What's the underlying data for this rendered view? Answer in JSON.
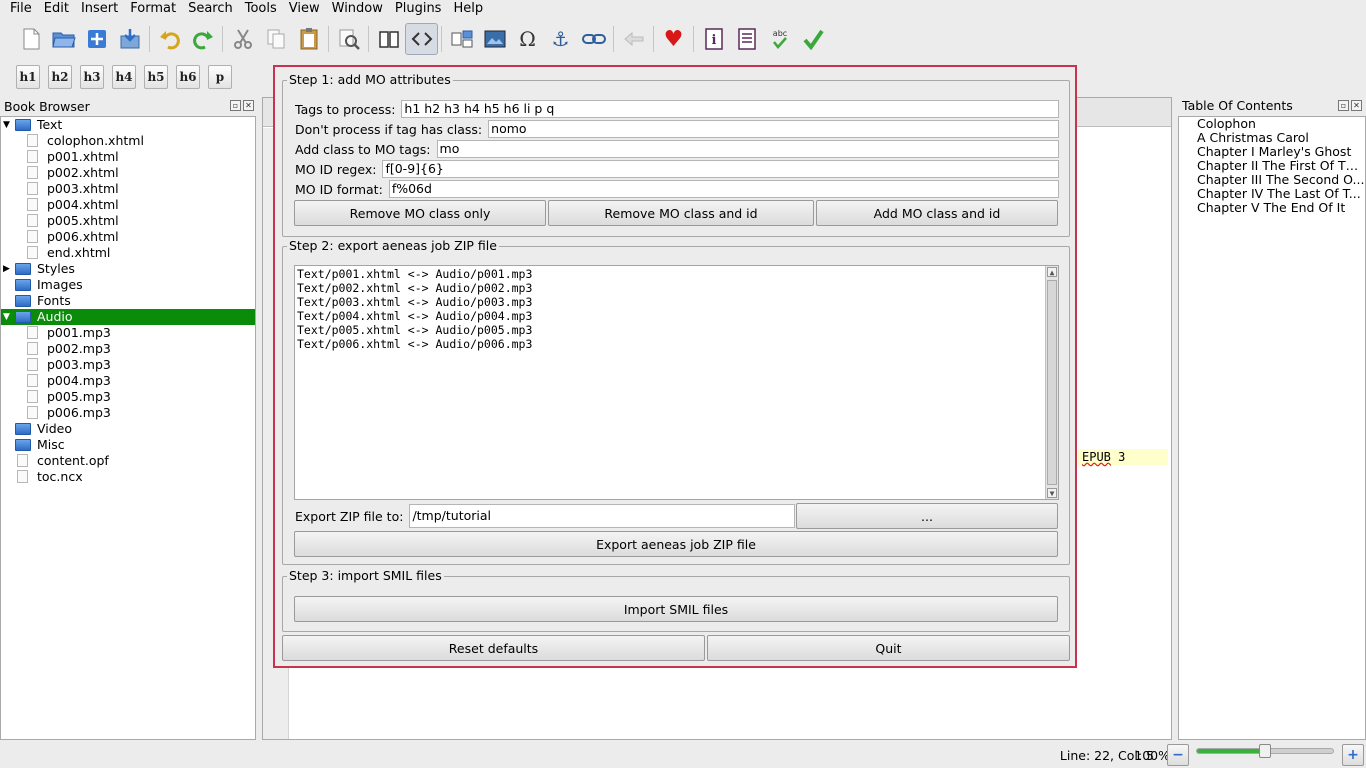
{
  "menu": [
    "File",
    "Edit",
    "Insert",
    "Format",
    "Search",
    "Tools",
    "View",
    "Window",
    "Plugins",
    "Help"
  ],
  "heading_buttons": [
    "h1",
    "h2",
    "h3",
    "h4",
    "h5",
    "h6",
    "p"
  ],
  "book_browser": {
    "title": "Book Browser",
    "tree": [
      {
        "label": "Text",
        "type": "folder",
        "expanded": true
      },
      {
        "label": "colophon.xhtml",
        "type": "file",
        "child": true
      },
      {
        "label": "p001.xhtml",
        "type": "file",
        "child": true
      },
      {
        "label": "p002.xhtml",
        "type": "file",
        "child": true
      },
      {
        "label": "p003.xhtml",
        "type": "file",
        "child": true
      },
      {
        "label": "p004.xhtml",
        "type": "file",
        "child": true
      },
      {
        "label": "p005.xhtml",
        "type": "file",
        "child": true
      },
      {
        "label": "p006.xhtml",
        "type": "file",
        "child": true
      },
      {
        "label": "end.xhtml",
        "type": "file",
        "child": true
      },
      {
        "label": "Styles",
        "type": "folder",
        "collapsed": true
      },
      {
        "label": "Images",
        "type": "folder"
      },
      {
        "label": "Fonts",
        "type": "folder"
      },
      {
        "label": "Audio",
        "type": "folder",
        "expanded": true,
        "selected": true
      },
      {
        "label": "p001.mp3",
        "type": "file",
        "child": true
      },
      {
        "label": "p002.mp3",
        "type": "file",
        "child": true
      },
      {
        "label": "p003.mp3",
        "type": "file",
        "child": true
      },
      {
        "label": "p004.mp3",
        "type": "file",
        "child": true
      },
      {
        "label": "p005.mp3",
        "type": "file",
        "child": true
      },
      {
        "label": "p006.mp3",
        "type": "file",
        "child": true
      },
      {
        "label": "Video",
        "type": "folder"
      },
      {
        "label": "Misc",
        "type": "folder"
      },
      {
        "label": "content.opf",
        "type": "file"
      },
      {
        "label": "toc.ncx",
        "type": "file"
      }
    ]
  },
  "editor": {
    "highlight_text_a": "EPUB",
    "highlight_text_b": " 3"
  },
  "toc": {
    "title": "Table Of Contents",
    "items": [
      "Colophon",
      "A Christmas Carol",
      "Chapter I Marley's Ghost",
      "Chapter II The First Of Th...",
      "Chapter III The Second O...",
      "Chapter IV The Last Of T...",
      "Chapter V The End Of It"
    ]
  },
  "dialog": {
    "step1": {
      "title": "Step 1: add MO attributes",
      "tags_label": "Tags to process:",
      "tags_value": "h1 h2 h3 h4 h5 h6 li p q",
      "noproc_label": "Don't process if tag has class:",
      "noproc_value": "nomo",
      "addclass_label": "Add class to MO tags:",
      "addclass_value": "mo",
      "regex_label": "MO ID regex:",
      "regex_value": "f[0-9]{6}",
      "format_label": "MO ID format:",
      "format_value": "f%06d",
      "btn_remove_class": "Remove MO class only",
      "btn_remove_class_id": "Remove MO class and id",
      "btn_add_class_id": "Add MO class and id"
    },
    "step2": {
      "title": "Step 2: export aeneas job ZIP file",
      "mappings": [
        "Text/p001.xhtml <-> Audio/p001.mp3",
        "Text/p002.xhtml <-> Audio/p002.mp3",
        "Text/p003.xhtml <-> Audio/p003.mp3",
        "Text/p004.xhtml <-> Audio/p004.mp3",
        "Text/p005.xhtml <-> Audio/p005.mp3",
        "Text/p006.xhtml <-> Audio/p006.mp3"
      ],
      "export_label": "Export ZIP file to:",
      "export_value": "/tmp/tutorial",
      "browse_label": "...",
      "export_button": "Export aeneas job ZIP file"
    },
    "step3": {
      "title": "Step 3: import SMIL files",
      "import_button": "Import SMIL files"
    },
    "reset_button": "Reset defaults",
    "quit_button": "Quit"
  },
  "status": {
    "position": "Line: 22, Col: 5",
    "zoom": "100%",
    "zoom_level": 0.5
  },
  "colors": {
    "selection": "#0a8c0a",
    "dialog_border": "#c8334e"
  }
}
